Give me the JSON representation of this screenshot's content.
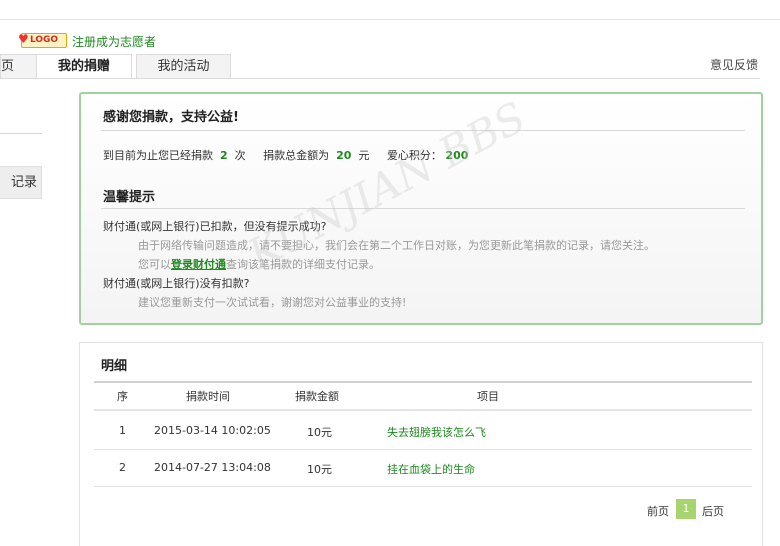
{
  "header": {
    "logo_text": "LOGO",
    "register_link": "注册成为志愿者"
  },
  "tabs": [
    {
      "label": "页"
    },
    {
      "label": "我的捐赠"
    },
    {
      "label": "我的活动"
    }
  ],
  "feedback_link": "意见反馈",
  "sidebar": {
    "record_label": "记录"
  },
  "thanks_box": {
    "title": "感谢您捐款，支持公益!",
    "stats": {
      "prefix": "到目前为止您已经捐款",
      "count": "2",
      "count_unit": "次",
      "total_label": "捐款总金额为",
      "total": "20",
      "total_unit": "元",
      "points_label": "爱心积分：",
      "points": "200"
    },
    "tips_title": "温馨提示",
    "tips": {
      "q1": "财付通(或网上银行)已扣款，但没有提示成功?",
      "a1": "由于网络传输问题造成，请不要担心，我们会在第二个工作日对账，为您更新此笔捐款的记录，请您关注。",
      "a2_prefix": "您可以",
      "a2_link": "登录财付通",
      "a2_suffix": "查询该笔捐款的详细支付记录。",
      "q2": "财付通(或网上银行)没有扣款?",
      "a3": "建议您重新支付一次试试看，谢谢您对公益事业的支持!"
    }
  },
  "detail": {
    "title": "明细",
    "columns": [
      "序",
      "捐款时间",
      "捐款金额",
      "项目"
    ],
    "rows": [
      {
        "no": "1",
        "time": "2015-03-14 10:02:05",
        "amount": "10元",
        "project": "失去翅膀我该怎么飞"
      },
      {
        "no": "2",
        "time": "2014-07-27 13:04:08",
        "amount": "10元",
        "project": "挂在血袋上的生命"
      }
    ],
    "pager": {
      "prev": "前页",
      "current": "1",
      "next": "后页"
    }
  },
  "watermark": "KUNJIAN BBS"
}
